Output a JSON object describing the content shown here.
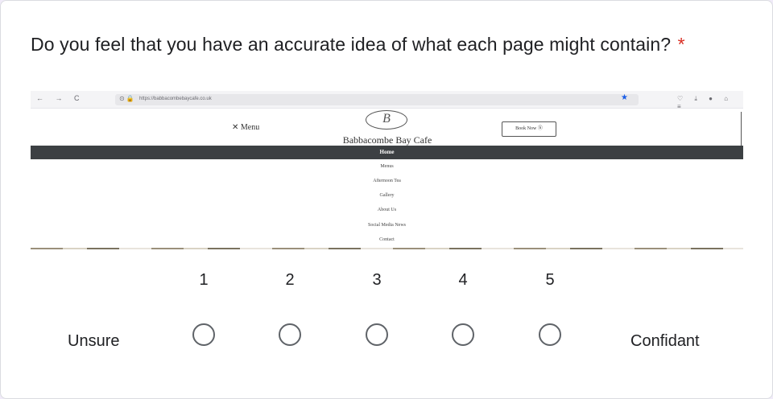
{
  "question": {
    "text": "Do you feel that you have an accurate idea of what each page might contain?",
    "required_marker": "*"
  },
  "screenshot": {
    "browser": {
      "nav_icons": "← → C",
      "url_icons": "⊙ 🔒",
      "url": "https://babbacombebaycafe.co.uk",
      "toolbar_icons": "♡ ⤓ ● ⌂ ≡"
    },
    "site": {
      "menu_label": "✕ Menu",
      "logo_letter": "B",
      "name": "Babbacombe Bay Cafe",
      "book_button": "Book Now ⓑ",
      "nav_items": [
        "Home",
        "Menus",
        "Afternoon Tea",
        "Gallery",
        "About Us",
        "Social Media News",
        "Contact"
      ]
    }
  },
  "scale": {
    "options": [
      "1",
      "2",
      "3",
      "4",
      "5"
    ],
    "low_label": "Unsure",
    "high_label": "Confidant"
  },
  "colors": {
    "required": "#d93025",
    "radio_border": "#5f6368",
    "nav_band": "#3c4043",
    "star": "#1a5de6"
  }
}
